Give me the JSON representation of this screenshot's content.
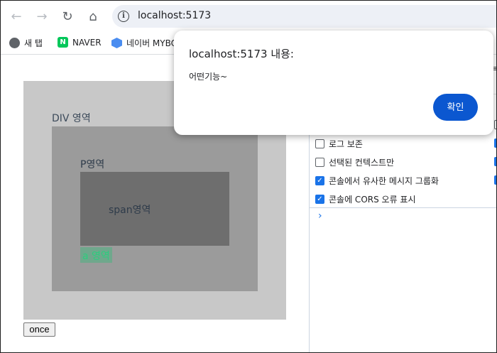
{
  "browser": {
    "url": "localhost:5173",
    "bookmarks": [
      {
        "label": "새 탭",
        "icon": "globe-icon"
      },
      {
        "label": "NAVER",
        "icon": "naver-icon"
      },
      {
        "label": "네이버 MYBO",
        "icon": "mybox-icon"
      }
    ]
  },
  "page": {
    "div_label": "DIV 영역",
    "p_label": "P영역",
    "span_label": "span영역",
    "a_label": "a 영역",
    "once_button": "once"
  },
  "devtools": {
    "options": [
      {
        "label": "로그 보존",
        "checked": false
      },
      {
        "label": "선택된 컨텍스트만",
        "checked": false
      },
      {
        "label": "콘솔에서 유사한 메시지 그룹화",
        "checked": true
      },
      {
        "label": "콘솔에 CORS 오류 표시",
        "checked": true
      }
    ],
    "prompt": "›",
    "cut_text": "≡"
  },
  "dialog": {
    "title": "localhost:5173 내용:",
    "message": "어떤기능~",
    "ok_label": "확인"
  },
  "colors": {
    "accent": "#0b57d0",
    "div_bg": "#c8c8c8",
    "p_bg": "#9b9b9b",
    "span_bg": "#6e6e6e",
    "a_bg": "#6fa88c"
  }
}
